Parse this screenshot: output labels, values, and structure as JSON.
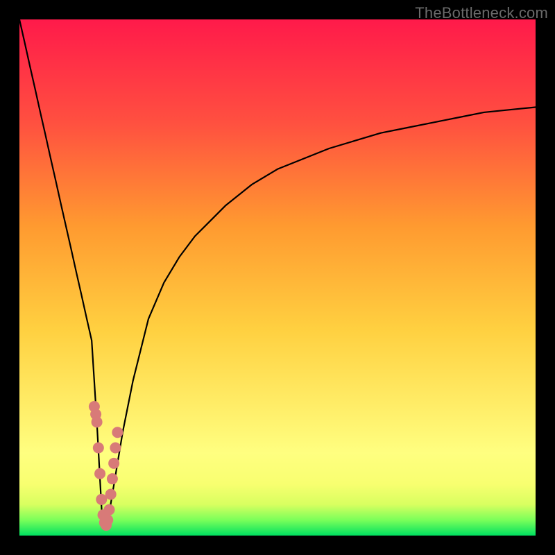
{
  "watermark": "TheBottleneck.com",
  "chart_data": {
    "type": "line",
    "title": "",
    "xlabel": "",
    "ylabel": "",
    "xlim": [
      0,
      100
    ],
    "ylim": [
      0,
      100
    ],
    "grid": false,
    "legend": false,
    "series": [
      {
        "name": "bottleneck-curve",
        "x": [
          0,
          1,
          2,
          3,
          4,
          5,
          6,
          7,
          8,
          9,
          10,
          11,
          12,
          13,
          14,
          15,
          16,
          17,
          18,
          19,
          20,
          21,
          22,
          23,
          24,
          25,
          28,
          31,
          34,
          37,
          40,
          45,
          50,
          55,
          60,
          65,
          70,
          75,
          80,
          85,
          90,
          95,
          100
        ],
        "y": [
          100,
          95.6,
          91.1,
          86.7,
          82.2,
          77.8,
          73.3,
          68.9,
          64.4,
          60.0,
          55.6,
          51.1,
          46.7,
          42.2,
          37.8,
          22.0,
          3.8,
          2.0,
          8.0,
          14.0,
          20.0,
          25.0,
          30.0,
          34.0,
          38.0,
          42.0,
          49.0,
          54.0,
          58.0,
          61.0,
          64.0,
          68.0,
          71.0,
          73.0,
          75.0,
          76.5,
          78.0,
          79.0,
          80.0,
          81.0,
          82.0,
          82.5,
          83.0
        ]
      },
      {
        "name": "marker-cluster",
        "x": [
          15.0,
          15.3,
          15.6,
          15.9,
          16.2,
          16.5,
          16.8,
          17.1,
          17.4,
          17.7,
          18.0,
          18.3,
          18.6,
          19.0,
          14.5,
          14.8
        ],
        "y": [
          22.0,
          17.0,
          12.0,
          7.0,
          4.0,
          2.5,
          2.0,
          3.0,
          5.0,
          8.0,
          11.0,
          14.0,
          17.0,
          20.0,
          25.0,
          23.5
        ]
      }
    ],
    "gradient_stops": [
      {
        "offset": 0.0,
        "color": "#00e060"
      },
      {
        "offset": 0.03,
        "color": "#7aff5a"
      },
      {
        "offset": 0.06,
        "color": "#d8ff60"
      },
      {
        "offset": 0.1,
        "color": "#f8ff70"
      },
      {
        "offset": 0.16,
        "color": "#ffff80"
      },
      {
        "offset": 0.4,
        "color": "#ffd040"
      },
      {
        "offset": 0.6,
        "color": "#ff9a30"
      },
      {
        "offset": 0.8,
        "color": "#ff5040"
      },
      {
        "offset": 1.0,
        "color": "#ff1a4a"
      }
    ],
    "marker": {
      "color": "#d87a78",
      "radius": 8
    }
  }
}
